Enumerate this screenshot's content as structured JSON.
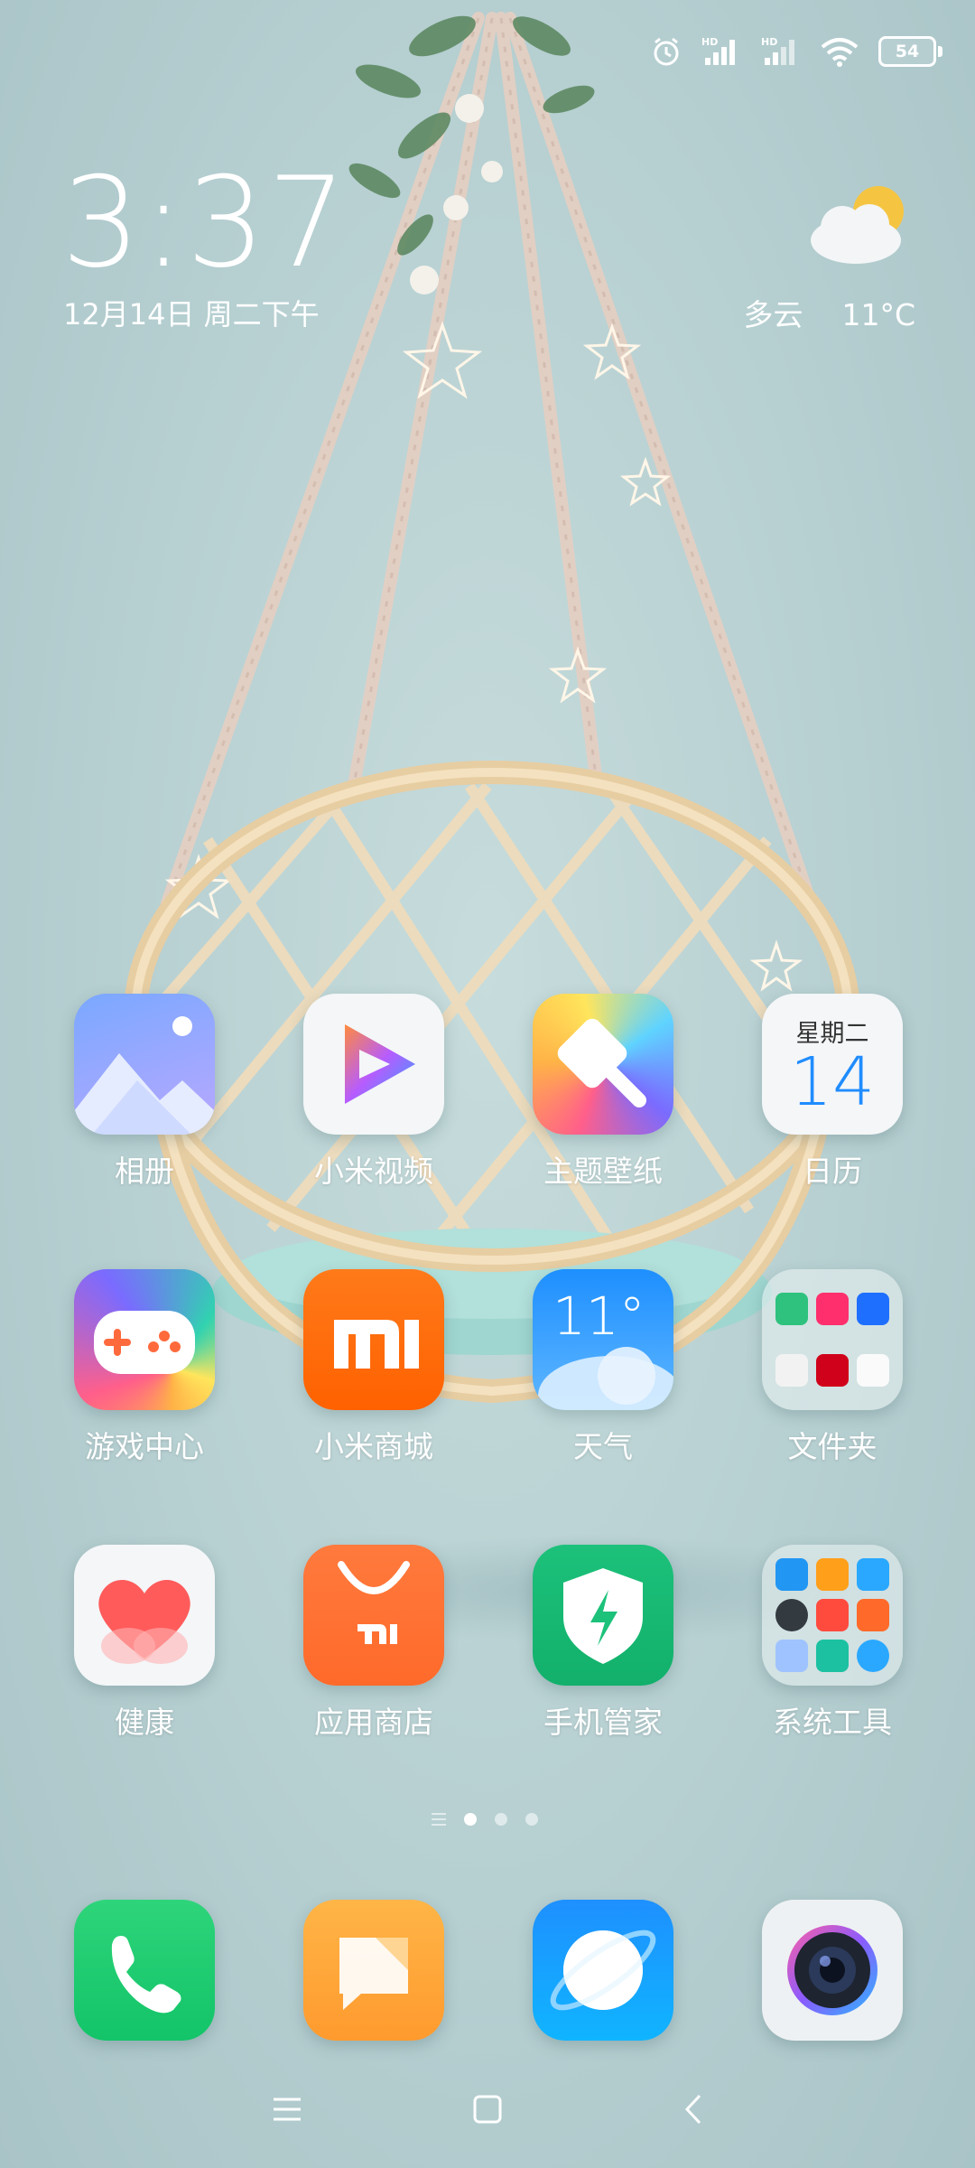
{
  "status_bar": {
    "icons": [
      "alarm-icon",
      "signal-hd-icon",
      "signal-hd-icon",
      "wifi-icon"
    ],
    "battery": "54"
  },
  "clock": {
    "time": "3:37",
    "date": "12月14日 周二下午"
  },
  "weather_widget": {
    "condition": "多云",
    "temperature": "11°C",
    "icon": "partly-cloudy-icon"
  },
  "calendar_icon": {
    "weekday": "星期二",
    "day": "14"
  },
  "weather_app_icon": {
    "temp": "11°"
  },
  "apps": [
    {
      "label": "相册",
      "icon": "gallery-icon"
    },
    {
      "label": "小米视频",
      "icon": "video-play-icon"
    },
    {
      "label": "主题壁纸",
      "icon": "theme-brush-icon"
    },
    {
      "label": "日历",
      "icon": "calendar-icon"
    },
    {
      "label": "游戏中心",
      "icon": "gamepad-icon"
    },
    {
      "label": "小米商城",
      "icon": "mi-logo-icon"
    },
    {
      "label": "天气",
      "icon": "weather-icon"
    },
    {
      "label": "文件夹",
      "icon": "folder-icon"
    },
    {
      "label": "健康",
      "icon": "heart-icon"
    },
    {
      "label": "应用商店",
      "icon": "app-store-bag-icon"
    },
    {
      "label": "手机管家",
      "icon": "security-shield-icon"
    },
    {
      "label": "系统工具",
      "icon": "tools-folder-icon"
    }
  ],
  "page_indicator": {
    "count": 3,
    "active_index": 0
  },
  "dock": [
    {
      "icon": "phone-icon"
    },
    {
      "icon": "messages-icon"
    },
    {
      "icon": "browser-icon"
    },
    {
      "icon": "camera-icon"
    }
  ],
  "navigation": [
    "menu-icon",
    "home-icon",
    "back-icon"
  ]
}
